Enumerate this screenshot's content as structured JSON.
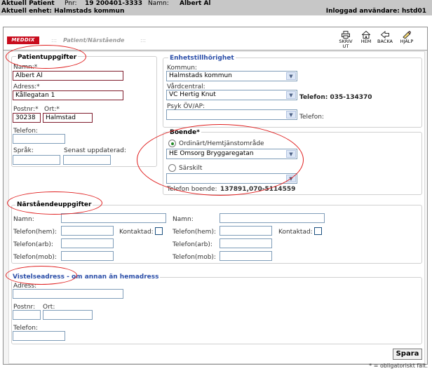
{
  "header": {
    "patient_label": "Aktuell Patient",
    "pnr_label": "Pnr:",
    "pnr_value": "19 200401-3333",
    "name_label": "Namn:",
    "name_value": "Albert Al",
    "unit_text": "Aktuell enhet: Halmstads kommun",
    "logged_in_text": "Inloggad användare: hstd01"
  },
  "titlebar": {
    "logo": "MEDDIX",
    "page_title": "Patient/Närstående",
    "tools": [
      {
        "label": "SKRIV UT",
        "icon": "printer-icon"
      },
      {
        "label": "HEM",
        "icon": "home-icon"
      },
      {
        "label": "BACKA",
        "icon": "back-icon"
      },
      {
        "label": "HJÄLP",
        "icon": "help-icon"
      }
    ]
  },
  "patient": {
    "title": "Patientuppgifter",
    "name_label": "Namn:*",
    "name_value": "Albert Al",
    "address_label": "Adress:*",
    "address_value": "Kållegatan 1",
    "postnr_label": "Postnr:*",
    "postnr_value": "30238",
    "city_label": "Ort:*",
    "city_value": "Halmstad",
    "phone_label": "Telefon:",
    "phone_value": "",
    "language_label": "Språk:",
    "language_value": "",
    "updated_label": "Senast uppdaterad:",
    "updated_value": ""
  },
  "unit": {
    "title": "Enhetstillhörighet",
    "kommun_label": "Kommun:",
    "kommun_value": "Halmstads kommun",
    "vardcentral_label": "Vårdcentral:",
    "vardcentral_value": "VC Hertig Knut",
    "vc_phone_text": "Telefon: 035-134370",
    "psyk_label": "Psyk ÖV/AP:",
    "psyk_value": "",
    "psyk_phone_text": "Telefon:"
  },
  "boende": {
    "title": "Boende*",
    "option_ordinary": "Ordinärt/Hemtjänstområde",
    "ordinary_value": "HE Omsorg Bryggaregatan",
    "option_special": "Särskilt",
    "special_value": "",
    "phone_text": "Telefon boende:",
    "phone_value": "137891,070-5114559",
    "selected": "ordinary"
  },
  "relatives": {
    "title": "Närståendeuppgifter",
    "name_label": "Namn:",
    "phone_home_label": "Telefon(hem):",
    "phone_work_label": "Telefon(arb):",
    "phone_mobile_label": "Telefon(mob):",
    "contacted_label": "Kontaktad:"
  },
  "visit": {
    "title_part1": "Vistelseadress",
    "title_part2": "- om annan än hemadress",
    "address_label": "Adress:",
    "postnr_label": "Postnr:",
    "city_label": "Ort:",
    "phone_label": "Telefon:"
  },
  "save_label": "Spara",
  "footnote": "* = obligatoriskt fält.",
  "colors": {
    "logo_red": "#c80b1c",
    "section_blue": "#2b4ea8",
    "annotation_red": "#e02020"
  }
}
